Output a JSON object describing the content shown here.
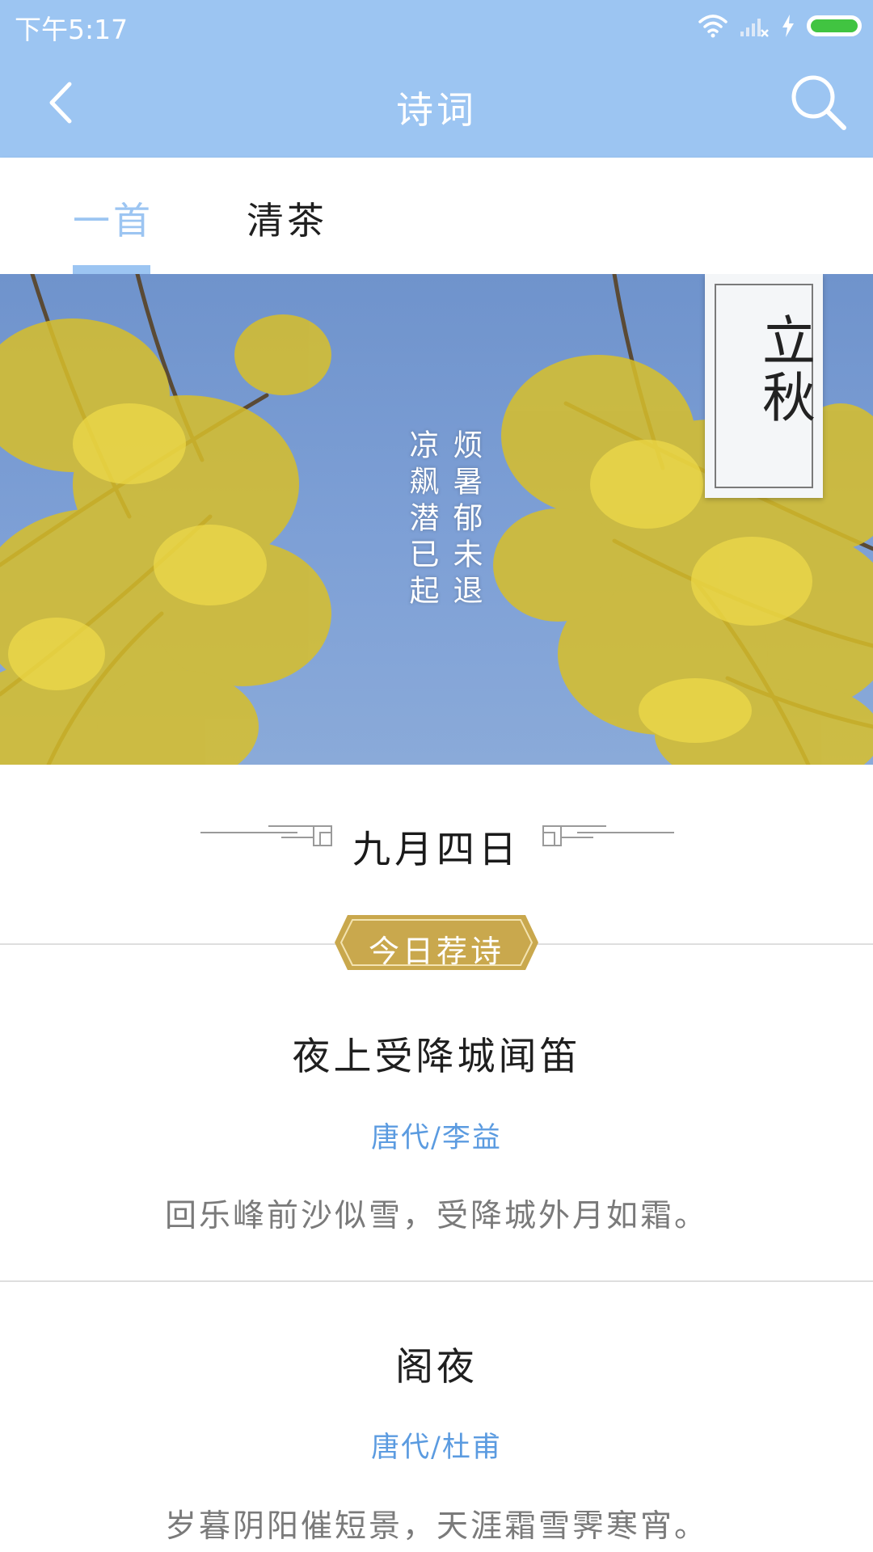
{
  "status_bar": {
    "time": "下午5:17",
    "battery_level": 1.0,
    "battery_color": "#41c441",
    "icons": [
      "wifi-icon",
      "signal-icon",
      "charging-icon",
      "battery-icon"
    ]
  },
  "app_bar": {
    "title": "诗词",
    "back_icon": "chevron-left-icon",
    "search_icon": "search-icon",
    "background": "#9cc5f2"
  },
  "tabs": {
    "items": [
      {
        "label": "一首",
        "active": true
      },
      {
        "label": "清茶",
        "active": false
      }
    ],
    "accent_color": "#9cc5f2"
  },
  "banner": {
    "solar_term": "立秋",
    "poem_lines": [
      "烦暑郁未退",
      "凉飙潜已起"
    ]
  },
  "date_heading": "九月四日",
  "recommend_badge": "今日荐诗",
  "poems": [
    {
      "title": "夜上受降城闻笛",
      "meta": "唐代/李益",
      "excerpt": "回乐峰前沙似雪，受降城外月如霜。"
    },
    {
      "title": "阁夜",
      "meta": "唐代/杜甫",
      "excerpt": "岁暮阴阳催短景，天涯霜雪霁寒宵。"
    }
  ],
  "colors": {
    "link_blue": "#5b9be0",
    "badge_gold": "#c9a84d",
    "excerpt_gray": "#7a7a7a"
  }
}
